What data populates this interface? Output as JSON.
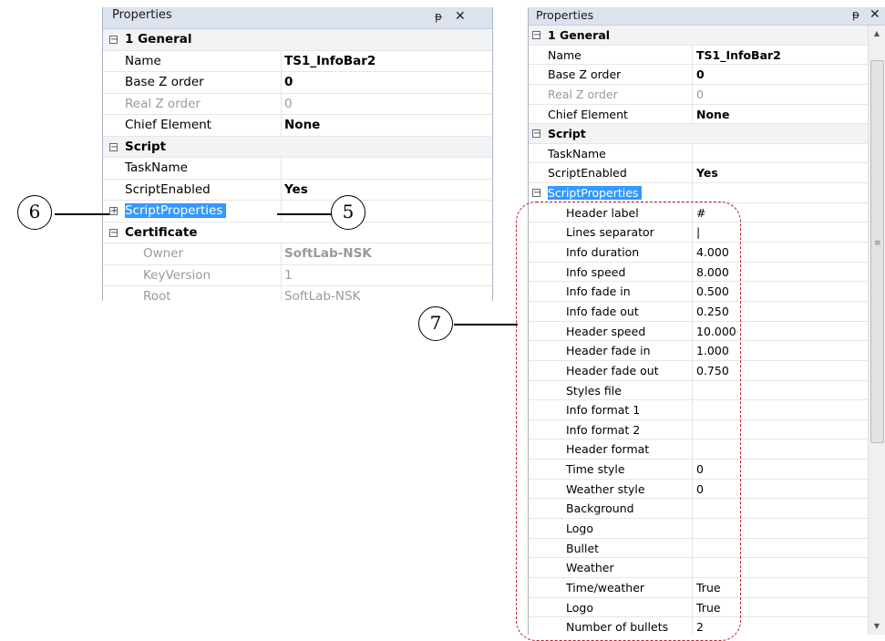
{
  "left_panel": {
    "title": "Properties",
    "pin_glyph": "ᵽ",
    "close_glyph": "✕",
    "rows": [
      {
        "kind": "cat",
        "expander": "⊟",
        "name": "1 General",
        "value": ""
      },
      {
        "kind": "prop",
        "name": "Name",
        "value": "TS1_InfoBar2",
        "bold": true
      },
      {
        "kind": "prop",
        "name": "Base Z order",
        "value": "0",
        "bold": true
      },
      {
        "kind": "prop",
        "dim": true,
        "name": "Real Z order",
        "value": "0"
      },
      {
        "kind": "prop",
        "name": "Chief Element",
        "value": "None",
        "bold": true
      },
      {
        "kind": "cat",
        "expander": "⊟",
        "name": "Script",
        "value": ""
      },
      {
        "kind": "prop",
        "name": "TaskName",
        "value": ""
      },
      {
        "kind": "prop",
        "name": "ScriptEnabled",
        "value": "Yes",
        "bold": true
      },
      {
        "kind": "prop",
        "expander": "⊞",
        "selected": true,
        "name": "ScriptProperties",
        "value": ""
      },
      {
        "kind": "cat-plain",
        "expander": "⊟",
        "name": "Certificate",
        "value": ""
      },
      {
        "kind": "sub",
        "dim": true,
        "name": "Owner",
        "value": "SoftLab-NSK",
        "bold": true
      },
      {
        "kind": "sub",
        "dim": true,
        "name": "KeyVersion",
        "value": "1"
      },
      {
        "kind": "sub",
        "dim": true,
        "name": "Root",
        "value": "SoftLab-NSK"
      }
    ]
  },
  "right_panel": {
    "title": "Properties",
    "pin_glyph": "ᵽ",
    "close_glyph": "✕",
    "scroll_up": "▲",
    "scroll_down": "▼",
    "grip": "≡",
    "rows": [
      {
        "kind": "cat",
        "expander": "⊟",
        "name": "1 General",
        "value": ""
      },
      {
        "kind": "prop",
        "name": "Name",
        "value": "TS1_InfoBar2",
        "bold": true
      },
      {
        "kind": "prop",
        "name": "Base Z order",
        "value": "0",
        "bold": true
      },
      {
        "kind": "prop",
        "dim": true,
        "name": "Real Z order",
        "value": "0"
      },
      {
        "kind": "prop",
        "name": "Chief Element",
        "value": "None",
        "bold": true
      },
      {
        "kind": "cat",
        "expander": "⊟",
        "name": "Script",
        "value": ""
      },
      {
        "kind": "prop",
        "name": "TaskName",
        "value": ""
      },
      {
        "kind": "prop",
        "name": "ScriptEnabled",
        "value": "Yes",
        "bold": true
      },
      {
        "kind": "prop",
        "expander": "⊟",
        "selected": true,
        "name": "ScriptProperties",
        "value": ""
      },
      {
        "kind": "sub",
        "name": "Header label",
        "value": "#"
      },
      {
        "kind": "sub",
        "name": "Lines separator",
        "value": "|"
      },
      {
        "kind": "sub",
        "name": "Info duration",
        "value": "4.000"
      },
      {
        "kind": "sub",
        "name": "Info speed",
        "value": "8.000"
      },
      {
        "kind": "sub",
        "name": "Info fade in",
        "value": "0.500"
      },
      {
        "kind": "sub",
        "name": "Info fade out",
        "value": "0.250"
      },
      {
        "kind": "sub",
        "name": "Header speed",
        "value": "10.000"
      },
      {
        "kind": "sub",
        "name": "Header fade in",
        "value": "1.000"
      },
      {
        "kind": "sub",
        "name": "Header fade out",
        "value": "0.750"
      },
      {
        "kind": "sub",
        "name": "Styles file",
        "value": ""
      },
      {
        "kind": "sub",
        "name": "Info format 1",
        "value": ""
      },
      {
        "kind": "sub",
        "name": "Info format 2",
        "value": ""
      },
      {
        "kind": "sub",
        "name": "Header format",
        "value": ""
      },
      {
        "kind": "sub",
        "name": "Time style",
        "value": "0"
      },
      {
        "kind": "sub",
        "name": "Weather style",
        "value": "0"
      },
      {
        "kind": "sub",
        "name": "Background",
        "value": ""
      },
      {
        "kind": "sub",
        "name": "Logo",
        "value": ""
      },
      {
        "kind": "sub",
        "name": "Bullet",
        "value": ""
      },
      {
        "kind": "sub",
        "name": "Weather",
        "value": ""
      },
      {
        "kind": "sub",
        "name": "Time/weather",
        "value": "True"
      },
      {
        "kind": "sub",
        "name": "Logo",
        "value": "True"
      },
      {
        "kind": "sub",
        "name": "Number of bullets",
        "value": "2"
      }
    ]
  },
  "callouts": {
    "c5": "5",
    "c6": "6",
    "c7": "7"
  },
  "colors": {
    "selection": "#3399ff",
    "title_bar": "#dde3ee",
    "dashed_frame": "#c0202a"
  }
}
